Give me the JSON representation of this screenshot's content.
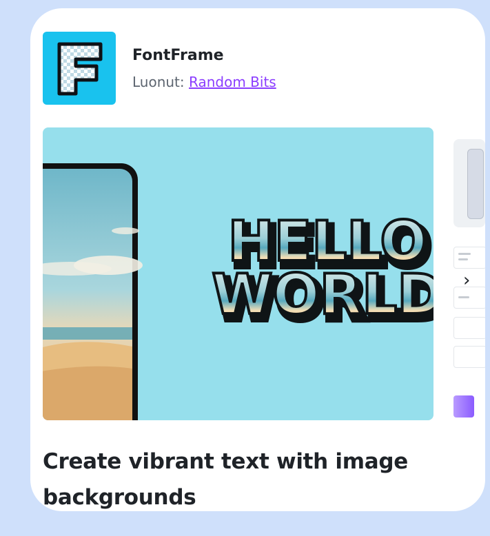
{
  "app": {
    "name": "FontFrame",
    "by_prefix": "Luonut:",
    "developer": "Random Bits",
    "logo_letter": "F"
  },
  "preview": {
    "headline_lines": [
      "HELLO",
      "WORLD"
    ]
  },
  "gallery": {
    "next_icon": "chevron-right-icon"
  },
  "description": {
    "headline": "Create vibrant text with image backgrounds"
  },
  "colors": {
    "page_bg": "#cfe0fb",
    "logo_bg": "#19c2ee",
    "preview_bg": "#96dfec",
    "link": "#8b3dff"
  }
}
